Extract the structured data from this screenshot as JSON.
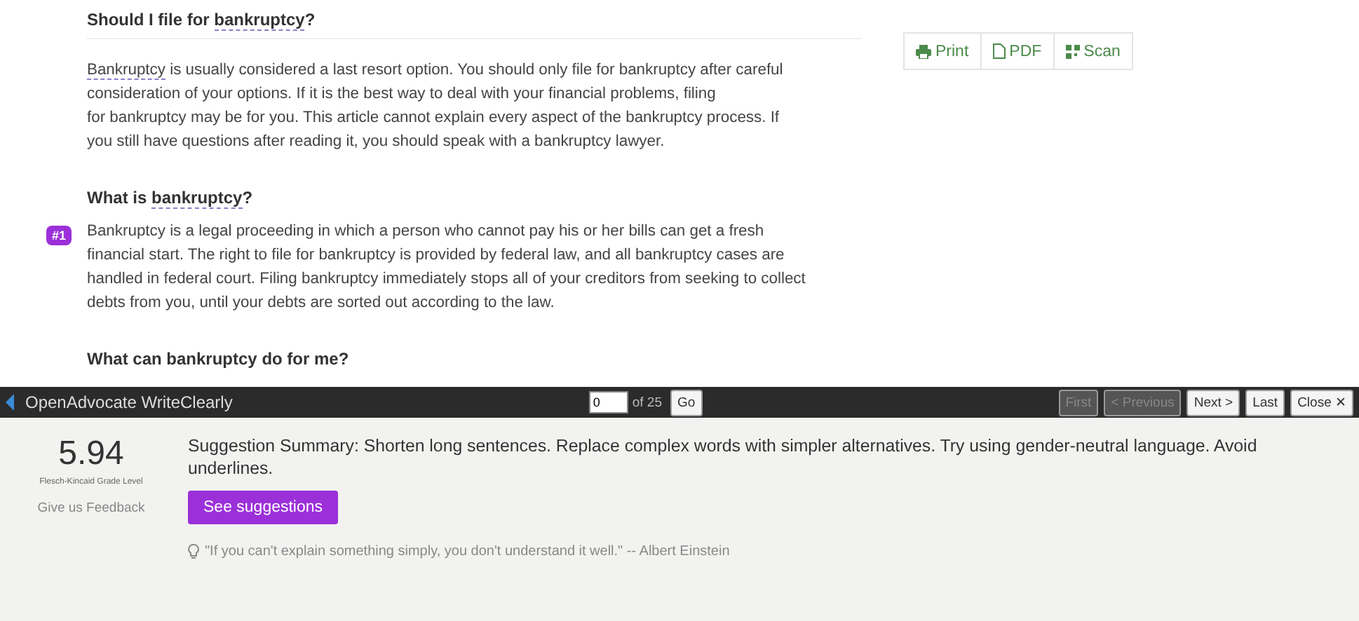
{
  "article": {
    "sections": [
      {
        "heading": [
          {
            "text": "Should I file for ",
            "flagged": false
          },
          {
            "text": "bankruptcy",
            "flagged": true
          },
          {
            "text": "?",
            "flagged": false
          }
        ],
        "rule": true,
        "paragraph": [
          {
            "text": "Bankruptcy",
            "flagged": true
          },
          {
            "text": " is usually considered a last resort option. You should only file for bankruptcy after careful\nconsideration of your options. If it is the best way to deal with your financial problems, filing\nfor bankruptcy may be for you. This article cannot explain every aspect of the bankruptcy process. If\nyou still have questions after reading it, you should speak with a bankruptcy lawyer.",
            "flagged": false
          }
        ]
      },
      {
        "heading": [
          {
            "text": "What is ",
            "flagged": false
          },
          {
            "text": "bankruptcy",
            "flagged": true
          },
          {
            "text": "?",
            "flagged": false
          }
        ],
        "rule": false,
        "marker": "#1",
        "paragraph": [
          {
            "text": "Bankruptcy is a legal proceeding in which a person who cannot pay his or her bills can get a fresh\nfinancial start. The right to file for bankruptcy is provided by federal law, and all bankruptcy cases are\nhandled in federal court. Filing bankruptcy immediately stops all of your creditors from seeking to collect\ndebts from you, until your debts are sorted out according to the law.",
            "flagged": false
          }
        ]
      },
      {
        "heading": [
          {
            "text": "What can bankruptcy do for me?",
            "flagged": false
          }
        ],
        "rule": false
      }
    ]
  },
  "tools": [
    {
      "kind": "print",
      "label": "Print"
    },
    {
      "kind": "pdf",
      "label": "PDF"
    },
    {
      "kind": "scan",
      "label": "Scan"
    }
  ],
  "toolbar": {
    "title": "OpenAdvocate WriteClearly",
    "page_value": "0",
    "page_total": "of 25",
    "go": "Go",
    "nav": [
      {
        "label": "First",
        "disabled": true
      },
      {
        "label": "< Previous",
        "disabled": true
      },
      {
        "label": "Next >",
        "disabled": false
      },
      {
        "label": "Last",
        "disabled": false
      },
      {
        "label": "Close ✕",
        "disabled": false
      }
    ]
  },
  "panel": {
    "score": "5.94",
    "score_label": "Flesch-Kincaid Grade Level",
    "feedback": "Give us Feedback",
    "summary": "Suggestion Summary: Shorten long sentences. Replace complex words with simpler alternatives. Try using gender-neutral language. Avoid underlines.",
    "button": "See suggestions",
    "quote": "\"If you can't explain something simply, you don't understand it well.\" -- Albert Einstein"
  }
}
